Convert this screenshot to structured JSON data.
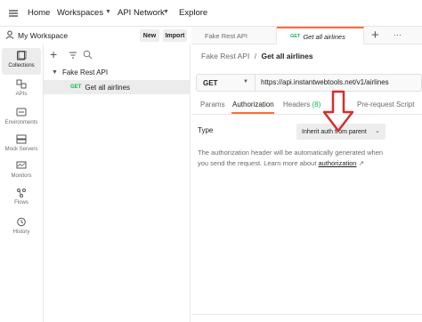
{
  "topbar": {
    "home_label": "Home",
    "workspaces_label": "Workspaces",
    "api_network_label": "API Network",
    "explore_label": "Explore"
  },
  "workspace": {
    "title": "My Workspace",
    "new_label": "New",
    "import_label": "Import"
  },
  "tabs": [
    {
      "label": "Fake Rest API"
    },
    {
      "method": "GET",
      "label": "Get all airlines"
    }
  ],
  "rail": [
    {
      "label": "Collections",
      "icon": "collections-icon"
    },
    {
      "label": "APIs",
      "icon": "apis-icon"
    },
    {
      "label": "Environments",
      "icon": "environments-icon"
    },
    {
      "label": "Mock Servers",
      "icon": "mock-servers-icon"
    },
    {
      "label": "Monitors",
      "icon": "monitors-icon"
    },
    {
      "label": "Flows",
      "icon": "flows-icon"
    },
    {
      "label": "History",
      "icon": "history-icon"
    }
  ],
  "tree": {
    "collection": "Fake Rest API",
    "request_method": "GET",
    "request": "Get all airlines"
  },
  "breadcrumb": {
    "parent": "Fake Rest API",
    "separator": "/",
    "current": "Get all airlines"
  },
  "request": {
    "method": "GET",
    "url": "https://api.instantwebtools.net/v1/airlines"
  },
  "subtabs": {
    "params": "Params",
    "authorization": "Authorization",
    "headers": "Headers",
    "headers_count": "(8)",
    "prerequest": "Pre-request Script"
  },
  "auth": {
    "type_label": "Type",
    "type_value": "Inherit auth from parent",
    "desc_line1": "The authorization header will be automatically generated when",
    "desc_line2": "you send the request. Learn more about",
    "desc_link": "authorization",
    "desc_link_suffix": "↗"
  },
  "colors": {
    "accent": "#ff6c37",
    "get": "#0cbb52",
    "annotation": "#d32f2f"
  }
}
